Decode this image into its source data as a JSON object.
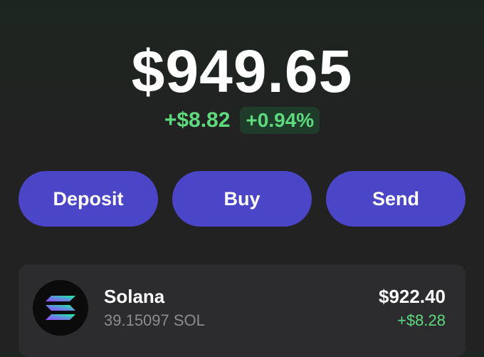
{
  "portfolio": {
    "balance": "$949.65",
    "change_amount": "+$8.82",
    "change_percent": "+0.94%"
  },
  "actions": {
    "deposit_label": "Deposit",
    "buy_label": "Buy",
    "send_label": "Send"
  },
  "tokens": [
    {
      "name": "Solana",
      "quantity": "39.15097 SOL",
      "value": "$922.40",
      "change": "+$8.28",
      "icon": "solana-logo-icon"
    }
  ],
  "colors": {
    "accent": "#4b45c8",
    "positive": "#5fd97d",
    "positive_bg": "#1f3b29",
    "card_bg": "#2c2c2f",
    "page_bg": "#222222"
  }
}
